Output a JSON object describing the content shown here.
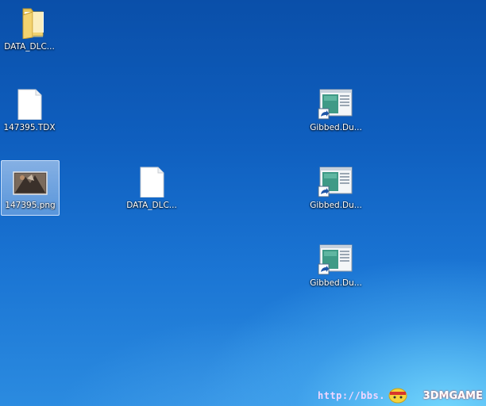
{
  "desktop": {
    "icons": [
      {
        "label": "DATA_DLC...",
        "type": "folder-icon"
      },
      {
        "label": "147395.TDX",
        "type": "blank-file-icon"
      },
      {
        "label": "147395.png",
        "type": "image-file-icon",
        "selected": true
      },
      {
        "label": "DATA_DLC...",
        "type": "blank-file-icon"
      },
      {
        "label": "Gibbed.Du...",
        "type": "app-shortcut-icon"
      },
      {
        "label": "Gibbed.Du...",
        "type": "app-shortcut-icon"
      },
      {
        "label": "Gibbed.Du...",
        "type": "app-shortcut-icon"
      }
    ]
  },
  "watermark": {
    "url": "http://bbs.",
    "brand": "3DMGAME"
  },
  "colors": {
    "background_top": "#0a4fa9",
    "background_glow": "#78dcff",
    "selection": "#cfe2fa"
  }
}
